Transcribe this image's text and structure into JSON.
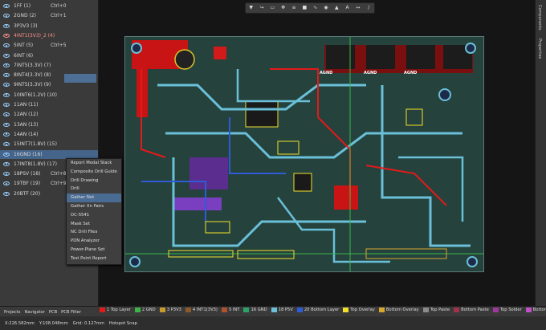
{
  "layers": [
    {
      "name": "1FF (1)",
      "shortcut": "Ctrl+0"
    },
    {
      "name": "2GND (2)",
      "shortcut": "Ctrl+1"
    },
    {
      "name": "3P3V3 (3)",
      "shortcut": ""
    },
    {
      "name": "4INT1(3V3)_2 (4)",
      "shortcut": ""
    },
    {
      "name": "5INT (5)",
      "shortcut": "Ctrl+5"
    },
    {
      "name": "6INT (6)",
      "shortcut": ""
    },
    {
      "name": "7INT5(3.3V) (7)",
      "shortcut": ""
    },
    {
      "name": "8INT4(3.3V) (8)",
      "shortcut": ""
    },
    {
      "name": "9INT5(3.3V) (9)",
      "shortcut": ""
    },
    {
      "name": "10INT6(1.2V) (10)",
      "shortcut": ""
    },
    {
      "name": "11AN (11)",
      "shortcut": ""
    },
    {
      "name": "12AN (12)",
      "shortcut": ""
    },
    {
      "name": "13AN (13)",
      "shortcut": ""
    },
    {
      "name": "14AN (14)",
      "shortcut": ""
    },
    {
      "name": "15INT7(1.8V) (15)",
      "shortcut": ""
    },
    {
      "name": "16GND (16)",
      "shortcut": ""
    },
    {
      "name": "17INT8(1.8V) (17)",
      "shortcut": ""
    },
    {
      "name": "18PSV (18)",
      "shortcut": "Ctrl+8"
    },
    {
      "name": "19TBF (19)",
      "shortcut": "Ctrl+9"
    },
    {
      "name": "20BTF (20)",
      "shortcut": ""
    }
  ],
  "context_menu": [
    "Report Modal Stack",
    "Composite Drill Guide",
    "Drill Drawing",
    "Drill",
    "Gather Net",
    "Gather Xn Pairs",
    "DC-5541",
    "Mask Set",
    "NC Drill Files",
    "PDN Analyzer",
    "Power-Plane Set",
    "Test Point Report"
  ],
  "right_tabs": [
    "Components",
    "Properties"
  ],
  "bottom_left_tabs": [
    "Projects",
    "Navigator",
    "PCB",
    "PCB Filter"
  ],
  "layer_tabs": [
    {
      "label": "1 Top Layer",
      "color": "#e31a1a"
    },
    {
      "label": "2 GND",
      "color": "#3bb54a"
    },
    {
      "label": "3 P3V3",
      "color": "#c99a2e"
    },
    {
      "label": "4 INT1(3V3)",
      "color": "#8a5a2b"
    },
    {
      "label": "5 INT",
      "color": "#b0522c"
    },
    {
      "label": "16 GND",
      "color": "#2aa36b"
    },
    {
      "label": "18 P5V",
      "color": "#6ac0d8"
    },
    {
      "label": "20 Bottom Layer",
      "color": "#2f5bd6"
    },
    {
      "label": "Top Overlay",
      "color": "#f2e12c"
    },
    {
      "label": "Bottom Overlay",
      "color": "#d8a82e"
    },
    {
      "label": "Top Paste",
      "color": "#8a8a8a"
    },
    {
      "label": "Bottom Paste",
      "color": "#a0324a"
    },
    {
      "label": "Top Solder",
      "color": "#a236a0"
    },
    {
      "label": "Bottom Solder",
      "color": "#c050c8"
    }
  ],
  "status": {
    "x": "X:226.582mm",
    "y": "Y:108.048mm",
    "grid": "Grid: 0.127mm",
    "snap": "Hotspot Snap"
  },
  "board_labels": [
    "AGND",
    "AGND",
    "AGND"
  ]
}
